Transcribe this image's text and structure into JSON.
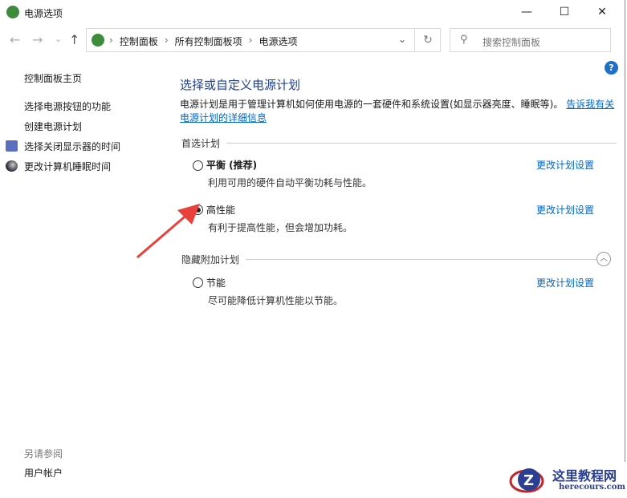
{
  "window": {
    "title": "电源选项",
    "minimize": "—",
    "maximize": "☐",
    "close": "✕"
  },
  "nav": {
    "back": "←",
    "forward": "→",
    "recent": "⌄",
    "up": "↑"
  },
  "address": {
    "crumbs": [
      "控制面板",
      "所有控制面板项",
      "电源选项"
    ],
    "separator": "›",
    "dropdown": "⌄",
    "refresh": "↻"
  },
  "search": {
    "placeholder": "搜索控制面板",
    "icon": "⚲"
  },
  "help": "?",
  "sidebar": {
    "home": "控制面板主页",
    "links": [
      "选择电源按钮的功能",
      "创建电源计划",
      "选择关闭显示器的时间",
      "更改计算机睡眠时间"
    ],
    "see_also": "另请参阅",
    "user_accounts": "用户帐户"
  },
  "main": {
    "heading": "选择或自定义电源计划",
    "description": "电源计划是用于管理计算机如何使用电源的一套硬件和系统设置(如显示器亮度、睡眠等)。",
    "more_link_1": "告诉我有关",
    "more_link_2": "电源计划的详细信息",
    "preferred_section": "首选计划",
    "hidden_section": "隐藏附加计划",
    "collapse": "︿",
    "plans": [
      {
        "name": "平衡 (推荐)",
        "desc": "利用可用的硬件自动平衡功耗与性能。",
        "link": "更改计划设置",
        "selected": false
      },
      {
        "name": "高性能",
        "desc": "有利于提高性能，但会增加功耗。",
        "link": "更改计划设置",
        "selected": true
      },
      {
        "name": "节能",
        "desc": "尽可能降低计算机性能以节能。",
        "link": "更改计划设置",
        "selected": false
      }
    ]
  },
  "watermark": {
    "title": "这里教程网",
    "url": "herecours.com"
  },
  "colors": {
    "accent": "#1c3f94",
    "link": "#0066cc",
    "arrow": "#e8413c"
  }
}
